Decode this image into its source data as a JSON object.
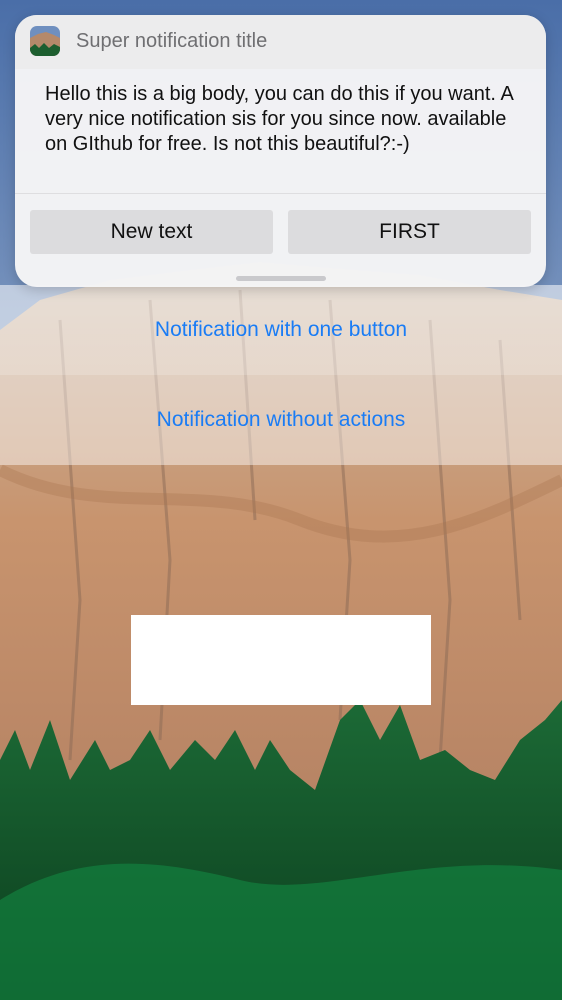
{
  "notification": {
    "app_icon": "yosemite-photo-icon",
    "title": "Super notification title",
    "body": "Hello this is a big body, you can do this if you want. A very nice notification sis for you since now. available on GIthub for free. Is not this beautiful?:-)",
    "actions": [
      {
        "label": "New text"
      },
      {
        "label": "FIRST"
      }
    ]
  },
  "list": {
    "items": [
      {
        "label": "Notification with one button"
      },
      {
        "label": "Notification without actions"
      }
    ]
  },
  "colors": {
    "link": "#1a7cf5",
    "card": "#f4f4f5",
    "button": "#dcdcde"
  }
}
